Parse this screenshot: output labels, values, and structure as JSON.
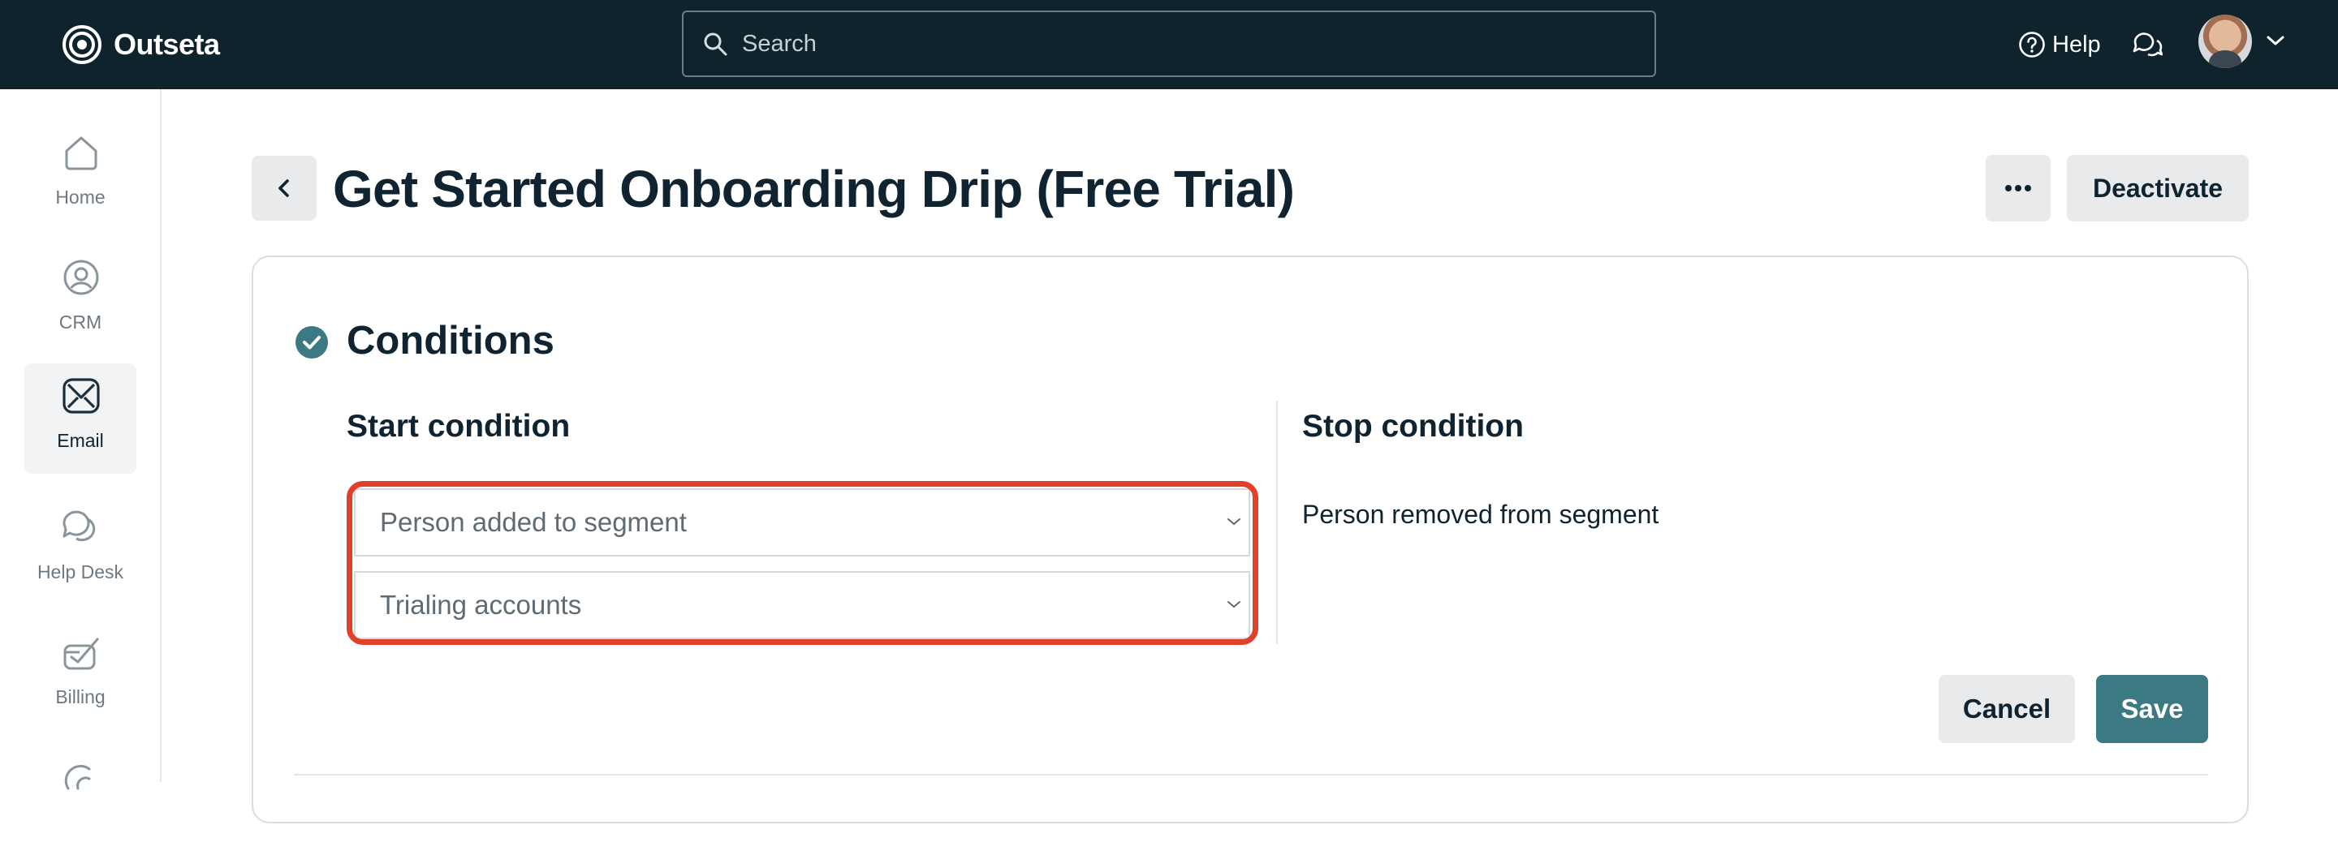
{
  "app": {
    "name": "Outseta"
  },
  "search": {
    "placeholder": "Search"
  },
  "header": {
    "help_label": "Help"
  },
  "sidebar": {
    "items": [
      {
        "label": "Home",
        "icon": "home-icon",
        "active": false
      },
      {
        "label": "CRM",
        "icon": "crm-icon",
        "active": false
      },
      {
        "label": "Email",
        "icon": "email-icon",
        "active": true
      },
      {
        "label": "Help Desk",
        "icon": "help-desk-icon",
        "active": false
      },
      {
        "label": "Billing",
        "icon": "billing-icon",
        "active": false
      },
      {
        "label": "",
        "icon": "more-nav-icon",
        "active": false
      }
    ]
  },
  "page": {
    "title": "Get Started Onboarding Drip (Free Trial)",
    "deactivate_label": "Deactivate"
  },
  "conditions": {
    "title": "Conditions",
    "start": {
      "title": "Start condition",
      "trigger_value": "Person added to segment",
      "segment_value": "Trialing accounts"
    },
    "stop": {
      "title": "Stop condition",
      "value": "Person removed from segment"
    },
    "cancel_label": "Cancel",
    "save_label": "Save"
  },
  "colors": {
    "topbar": "#0e232c",
    "accent": "#3b7a83",
    "highlight": "#e0412b"
  }
}
